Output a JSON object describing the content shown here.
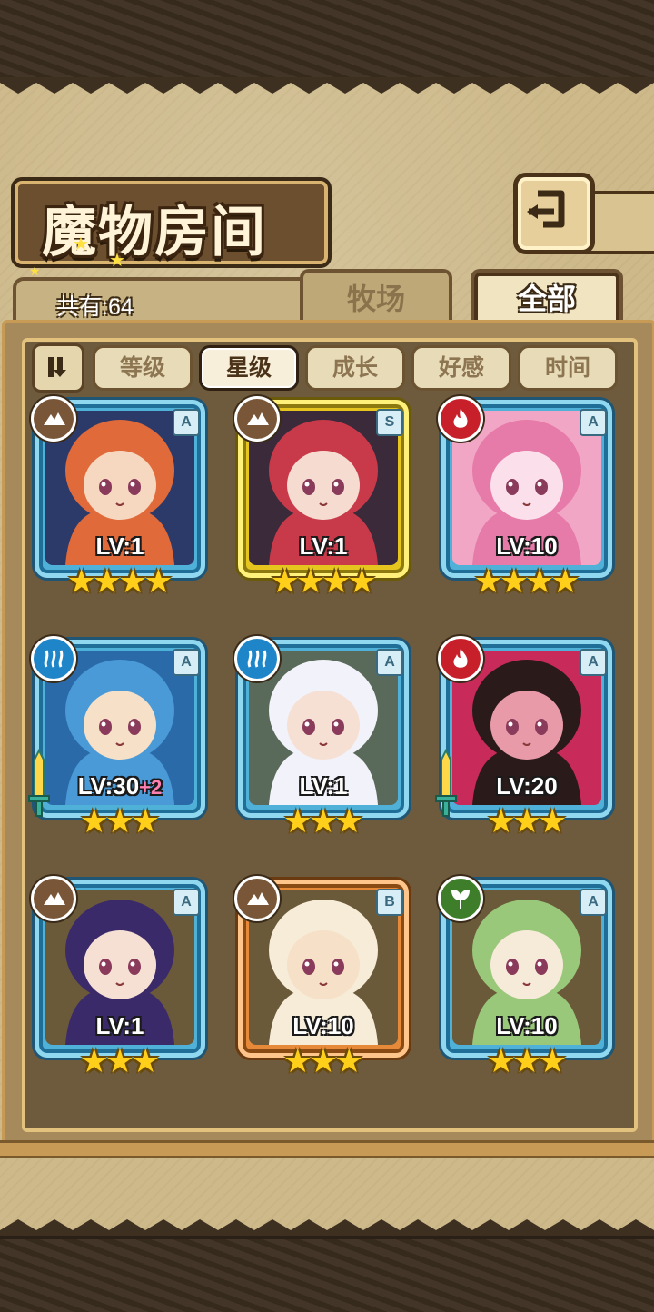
{
  "header": {
    "title": "魔物房间",
    "count_label": "共有:64"
  },
  "tabs": [
    {
      "label": "牧场",
      "active": false
    },
    {
      "label": "全部",
      "active": true
    }
  ],
  "sort_buttons": [
    {
      "label": "等级",
      "active": false
    },
    {
      "label": "星级",
      "active": true
    },
    {
      "label": "成长",
      "active": false
    },
    {
      "label": "好感",
      "active": false
    },
    {
      "label": "时间",
      "active": false
    }
  ],
  "monsters": [
    {
      "element": "earth-icon",
      "rank": "A",
      "level": "LV:1",
      "level_bonus": "",
      "stars": 4,
      "frame": "blue",
      "equipped": false,
      "palette": [
        "#2c3a6a",
        "#e06a3a",
        "#f6d8c0"
      ]
    },
    {
      "element": "earth-icon",
      "rank": "S",
      "level": "LV:1",
      "level_bonus": "",
      "stars": 4,
      "frame": "gold",
      "equipped": false,
      "palette": [
        "#3a2a3a",
        "#c83a4a",
        "#f6dcd0"
      ]
    },
    {
      "element": "fire-icon",
      "rank": "A",
      "level": "LV:10",
      "level_bonus": "",
      "stars": 4,
      "frame": "blue",
      "equipped": false,
      "palette": [
        "#f2a6c6",
        "#e67aa8",
        "#fbe0ec"
      ]
    },
    {
      "element": "water-icon",
      "rank": "A",
      "level": "LV:30",
      "level_bonus": "+2",
      "stars": 3,
      "frame": "blue",
      "equipped": true,
      "palette": [
        "#2a6aa8",
        "#4a9ad8",
        "#f6e0c8"
      ]
    },
    {
      "element": "water-icon",
      "rank": "A",
      "level": "LV:1",
      "level_bonus": "",
      "stars": 3,
      "frame": "blue",
      "equipped": false,
      "palette": [
        "#5a6a5a",
        "#f2f2fa",
        "#f6e0d4"
      ]
    },
    {
      "element": "fire-icon",
      "rank": "A",
      "level": "LV:20",
      "level_bonus": "",
      "stars": 3,
      "frame": "blue",
      "equipped": true,
      "palette": [
        "#c82a5a",
        "#2a1a1a",
        "#e89aa8"
      ]
    },
    {
      "element": "earth-icon",
      "rank": "A",
      "level": "LV:1",
      "level_bonus": "",
      "stars": 3,
      "frame": "blue",
      "equipped": false,
      "palette": [
        "#6a5a3a",
        "#3a2a6a",
        "#f6e0d4"
      ]
    },
    {
      "element": "earth-icon",
      "rank": "B",
      "level": "LV:10",
      "level_bonus": "",
      "stars": 3,
      "frame": "orange",
      "equipped": false,
      "palette": [
        "#6a5a3a",
        "#f6ecd8",
        "#f6e0c8"
      ]
    },
    {
      "element": "grass-icon",
      "rank": "A",
      "level": "LV:10",
      "level_bonus": "",
      "stars": 3,
      "frame": "blue",
      "equipped": false,
      "palette": [
        "#6a5a3a",
        "#9ac87a",
        "#f6ead8"
      ]
    }
  ]
}
